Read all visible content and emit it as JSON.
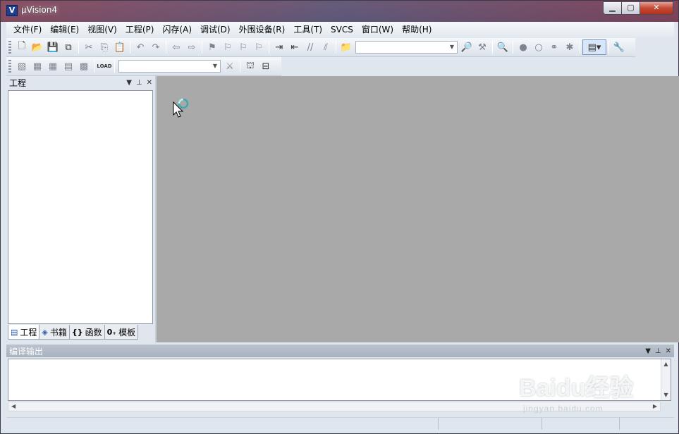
{
  "window": {
    "title": "µVision4",
    "icon": "V"
  },
  "menu": [
    "文件(F)",
    "编辑(E)",
    "视图(V)",
    "工程(P)",
    "闪存(A)",
    "调试(D)",
    "外围设备(R)",
    "工具(T)",
    "SVCS",
    "窗口(W)",
    "帮助(H)"
  ],
  "toolbar": {
    "combo1": "",
    "combo2": ""
  },
  "project_pane": {
    "title": "工程",
    "tabs": [
      {
        "icon": "▤",
        "label": "工程"
      },
      {
        "icon": "◈",
        "label": "书籍"
      },
      {
        "icon": "{}",
        "label": "函数"
      },
      {
        "icon": "0₊",
        "label": "模板"
      }
    ]
  },
  "output_pane": {
    "title": "编译输出"
  },
  "watermark": {
    "logo": "Baidu经验",
    "url": "jingyan.baidu.com"
  },
  "colors": {
    "editor_bg": "#a9a9a9",
    "pane_bg": "#dfe6ee"
  }
}
